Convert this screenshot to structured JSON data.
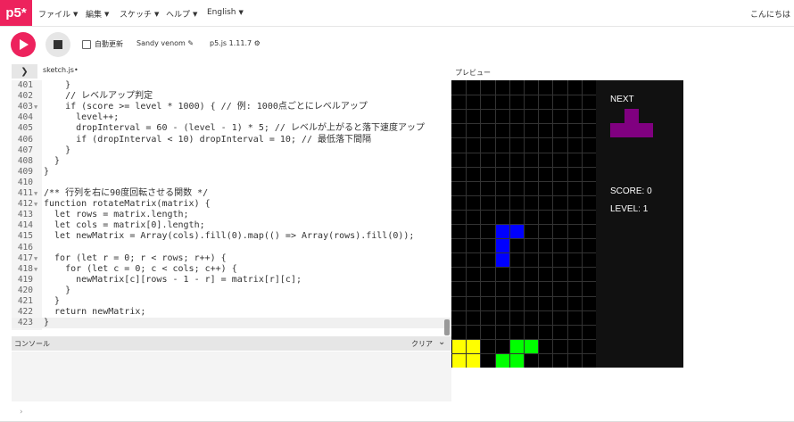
{
  "nav": {
    "logo": "p5*",
    "menus": [
      "ファイル",
      "編集",
      "スケッチ",
      "ヘルプ",
      "English"
    ],
    "greeting": "こんにちは"
  },
  "toolbar": {
    "auto_refresh": "自動更新",
    "sketch_name": "Sandy venom",
    "version": "p5.js 1.11.7"
  },
  "editor": {
    "tab": "sketch.js",
    "lines": [
      {
        "n": "401",
        "fold": "",
        "code": "    }"
      },
      {
        "n": "402",
        "fold": "",
        "code": "    // レベルアップ判定"
      },
      {
        "n": "403",
        "fold": "▼",
        "code": "    if (score >= level * 1000) { // 例: 1000点ごとにレベルアップ"
      },
      {
        "n": "404",
        "fold": "",
        "code": "      level++;"
      },
      {
        "n": "405",
        "fold": "",
        "code": "      dropInterval = 60 - (level - 1) * 5; // レベルが上がると落下速度アップ"
      },
      {
        "n": "406",
        "fold": "",
        "code": "      if (dropInterval < 10) dropInterval = 10; // 最低落下間隔"
      },
      {
        "n": "407",
        "fold": "",
        "code": "    }"
      },
      {
        "n": "408",
        "fold": "",
        "code": "  }"
      },
      {
        "n": "409",
        "fold": "",
        "code": "}"
      },
      {
        "n": "410",
        "fold": "",
        "code": ""
      },
      {
        "n": "411",
        "fold": "▼",
        "code": "/** 行列を右に90度回転させる関数 */"
      },
      {
        "n": "412",
        "fold": "▼",
        "code": "function rotateMatrix(matrix) {"
      },
      {
        "n": "413",
        "fold": "",
        "code": "  let rows = matrix.length;"
      },
      {
        "n": "414",
        "fold": "",
        "code": "  let cols = matrix[0].length;"
      },
      {
        "n": "415",
        "fold": "",
        "code": "  let newMatrix = Array(cols).fill(0).map(() => Array(rows).fill(0));"
      },
      {
        "n": "416",
        "fold": "",
        "code": ""
      },
      {
        "n": "417",
        "fold": "▼",
        "code": "  for (let r = 0; r < rows; r++) {"
      },
      {
        "n": "418",
        "fold": "▼",
        "code": "    for (let c = 0; c < cols; c++) {"
      },
      {
        "n": "419",
        "fold": "",
        "code": "      newMatrix[c][rows - 1 - r] = matrix[r][c];"
      },
      {
        "n": "420",
        "fold": "",
        "code": "    }"
      },
      {
        "n": "421",
        "fold": "",
        "code": "  }"
      },
      {
        "n": "422",
        "fold": "",
        "code": "  return newMatrix;"
      },
      {
        "n": "423",
        "fold": "",
        "code": "}"
      }
    ]
  },
  "console": {
    "title": "コンソール",
    "clear": "クリア",
    "prompt": "›"
  },
  "preview": {
    "label": "プレビュー",
    "next_label": "NEXT",
    "score_label": "SCORE: 0",
    "level_label": "LEVEL: 1",
    "colors": {
      "yellow": "#ffff00",
      "green": "#00ff00",
      "blue": "#0000ff",
      "purple": "#800080"
    }
  }
}
